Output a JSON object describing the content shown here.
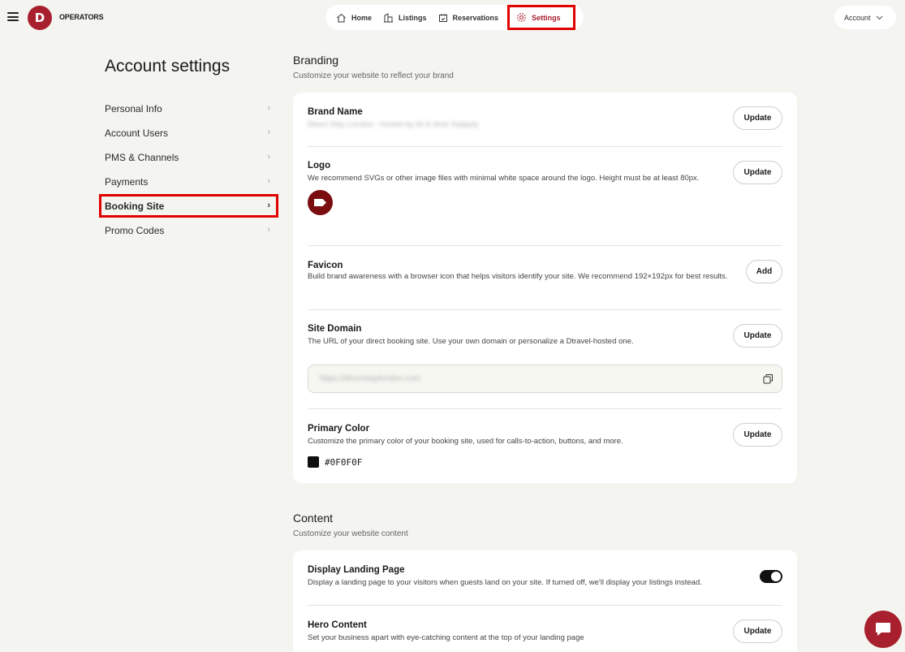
{
  "header": {
    "brand": "OPERATORS",
    "logo_letter": "D",
    "nav": [
      {
        "label": "Home"
      },
      {
        "label": "Listings"
      },
      {
        "label": "Reservations"
      },
      {
        "label": "Settings"
      }
    ],
    "account_label": "Account"
  },
  "sidebar": {
    "title": "Account settings",
    "items": [
      {
        "label": "Personal Info"
      },
      {
        "label": "Account Users"
      },
      {
        "label": "PMS & Channels"
      },
      {
        "label": "Payments"
      },
      {
        "label": "Booking Site"
      },
      {
        "label": "Promo Codes"
      }
    ],
    "arrow": "›"
  },
  "branding": {
    "title": "Branding",
    "subtitle": "Customize your website to reflect your brand",
    "brand_name": {
      "title": "Brand Name",
      "value": "Direct Stay London - hosted by Ali & Amir Sadjady",
      "button": "Update"
    },
    "logo": {
      "title": "Logo",
      "desc": "We recommend SVGs or other image files with minimal white space around the logo. Height must be at least 80px.",
      "button": "Update"
    },
    "favicon": {
      "title": "Favicon",
      "desc": "Build brand awareness with a browser icon that helps visitors identify your site. We recommend 192×192px for best results.",
      "button": "Add"
    },
    "site_domain": {
      "title": "Site Domain",
      "desc": "The URL of your direct booking site. Use your own domain or personalize a Dtravel-hosted one.",
      "value": "https://directstaylondon.com",
      "button": "Update"
    },
    "primary_color": {
      "title": "Primary Color",
      "desc": "Customize the primary color of your booking site, used for calls-to-action, buttons, and more.",
      "hex": "#0F0F0F",
      "swatch_color": "#0f0f0f",
      "button": "Update"
    }
  },
  "content": {
    "title": "Content",
    "subtitle": "Customize your website content",
    "landing": {
      "title": "Display Landing Page",
      "desc": "Display a landing page to your visitors when guests land on your site. If turned off, we'll display your listings instead.",
      "enabled": true
    },
    "hero": {
      "title": "Hero Content",
      "desc": "Set your business apart with eye-catching content at the top of your landing page",
      "button": "Update"
    }
  },
  "colors": {
    "brand": "#a8202e",
    "highlight": "#e00000"
  }
}
